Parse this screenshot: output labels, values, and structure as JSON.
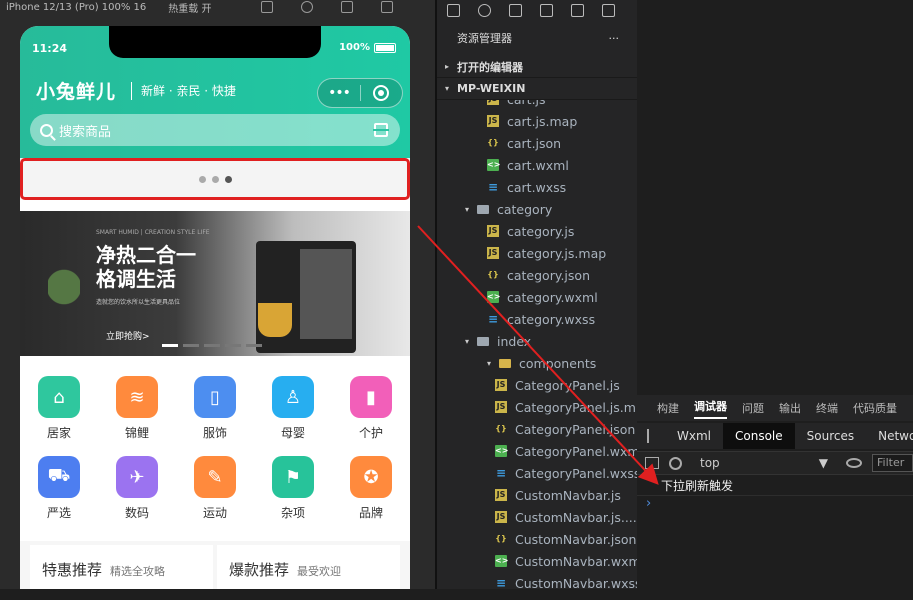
{
  "simulator": {
    "device_select": "iPhone 12/13 (Pro) 100% 16",
    "hotreload_select": "热重载 开",
    "status_time": "11:24",
    "battery": "100%"
  },
  "app": {
    "logo": "小兔鲜儿",
    "slogan": "新鲜 · 亲民 · 快捷",
    "capsule_dots": "•••",
    "search_placeholder": "搜索商品"
  },
  "banner": {
    "small_text": "SMART HUMID | CREATION STYLE LIFE",
    "title_line1": "净热二合一",
    "title_line2": "格调生活",
    "subtitle": "造就您的饮水所以生活更具品位",
    "buy_label": "立即抢购>"
  },
  "categories": [
    {
      "label": "居家",
      "color": "#2fc79e",
      "glyph": "⌂"
    },
    {
      "label": "锦鲤",
      "color": "#ff8a3d",
      "glyph": "≋"
    },
    {
      "label": "服饰",
      "color": "#4d8ef0",
      "glyph": "▯"
    },
    {
      "label": "母婴",
      "color": "#27aef0",
      "glyph": "♙"
    },
    {
      "label": "个护",
      "color": "#f25fb9",
      "glyph": "▮"
    },
    {
      "label": "严选",
      "color": "#4d7ef0",
      "glyph": "⛟"
    },
    {
      "label": "数码",
      "color": "#9b73f0",
      "glyph": "✈"
    },
    {
      "label": "运动",
      "color": "#ff8a3d",
      "glyph": "✎"
    },
    {
      "label": "杂项",
      "color": "#27c39a",
      "glyph": "⚑"
    },
    {
      "label": "品牌",
      "color": "#ff8a3d",
      "glyph": "✪"
    }
  ],
  "cards": [
    {
      "title": "特惠推荐",
      "sub": "精选全攻略"
    },
    {
      "title": "爆款推荐",
      "sub": "最受欢迎"
    }
  ],
  "explorer": {
    "title": "资源管理器",
    "more": "···",
    "open_editors": "打开的编辑器",
    "project": "MP-WEIXIN",
    "files": [
      {
        "name": "cart.js",
        "type": "js",
        "level": 2
      },
      {
        "name": "cart.js.map",
        "type": "js",
        "level": 2
      },
      {
        "name": "cart.json",
        "type": "json",
        "level": 2
      },
      {
        "name": "cart.wxml",
        "type": "wxml",
        "level": 2
      },
      {
        "name": "cart.wxss",
        "type": "wxss",
        "level": 2
      },
      {
        "name": "category",
        "type": "folder",
        "level": 1
      },
      {
        "name": "category.js",
        "type": "js",
        "level": 2
      },
      {
        "name": "category.js.map",
        "type": "js",
        "level": 2
      },
      {
        "name": "category.json",
        "type": "json",
        "level": 2
      },
      {
        "name": "category.wxml",
        "type": "wxml",
        "level": 2
      },
      {
        "name": "category.wxss",
        "type": "wxss",
        "level": 2
      },
      {
        "name": "index",
        "type": "folder",
        "level": 1
      },
      {
        "name": "components",
        "type": "folder-comp",
        "level": 2
      },
      {
        "name": "CategoryPanel.js",
        "type": "js",
        "level": 3
      },
      {
        "name": "CategoryPanel.js.m...",
        "type": "js",
        "level": 3
      },
      {
        "name": "CategoryPanel.json",
        "type": "json",
        "level": 3
      },
      {
        "name": "CategoryPanel.wxml",
        "type": "wxml",
        "level": 3
      },
      {
        "name": "CategoryPanel.wxss",
        "type": "wxss",
        "level": 3
      },
      {
        "name": "CustomNavbar.js",
        "type": "js",
        "level": 3
      },
      {
        "name": "CustomNavbar.js....",
        "type": "js",
        "level": 3
      },
      {
        "name": "CustomNavbar.json",
        "type": "json",
        "level": 3
      },
      {
        "name": "CustomNavbar.wxml",
        "type": "wxml",
        "level": 3
      },
      {
        "name": "CustomNavbar.wxss",
        "type": "wxss",
        "level": 3
      }
    ]
  },
  "devtools": {
    "panel_tabs": [
      "构建",
      "调试器",
      "问题",
      "输出",
      "终端",
      "代码质量"
    ],
    "active_panel": "调试器",
    "tool_tabs": [
      "Wxml",
      "Console",
      "Sources",
      "Network"
    ],
    "active_tool": "Console",
    "context": "top",
    "filter_placeholder": "Filter",
    "log_message": "下拉刷新触发",
    "prompt": "›"
  },
  "colors": {
    "brand": "#27bb9a",
    "highlight": "#e02020",
    "arrow": "#e02020"
  }
}
